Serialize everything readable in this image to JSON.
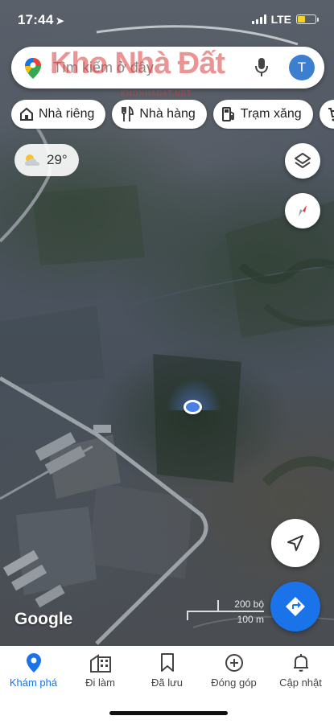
{
  "status_bar": {
    "time": "17:44",
    "network": "LTE"
  },
  "search": {
    "placeholder": "Tìm kiếm ở đây",
    "avatar_initial": "T"
  },
  "watermark": {
    "text": "Kho Nhà Đất",
    "subtext": "KHONHADAT.NET"
  },
  "chips": [
    {
      "label": "Nhà riêng",
      "icon": "home-icon"
    },
    {
      "label": "Nhà hàng",
      "icon": "restaurant-icon"
    },
    {
      "label": "Trạm xăng",
      "icon": "gas-station-icon"
    },
    {
      "label": "",
      "icon": "shopping-cart-icon"
    }
  ],
  "weather": {
    "temperature": "29°",
    "icon": "partly-cloudy-icon"
  },
  "map": {
    "attribution": "Google",
    "scale": {
      "imperial": "200 bộ",
      "metric": "100 m"
    }
  },
  "colors": {
    "accent": "#1a73e8",
    "location_dot": "#4a7fe8"
  },
  "bottom_nav": [
    {
      "label": "Khám phá",
      "icon": "explore-pin-icon",
      "active": true
    },
    {
      "label": "Đi làm",
      "icon": "commute-icon",
      "active": false
    },
    {
      "label": "Đã lưu",
      "icon": "bookmark-icon",
      "active": false
    },
    {
      "label": "Đóng góp",
      "icon": "add-circle-icon",
      "active": false
    },
    {
      "label": "Cập nhật",
      "icon": "bell-icon",
      "active": false
    }
  ]
}
